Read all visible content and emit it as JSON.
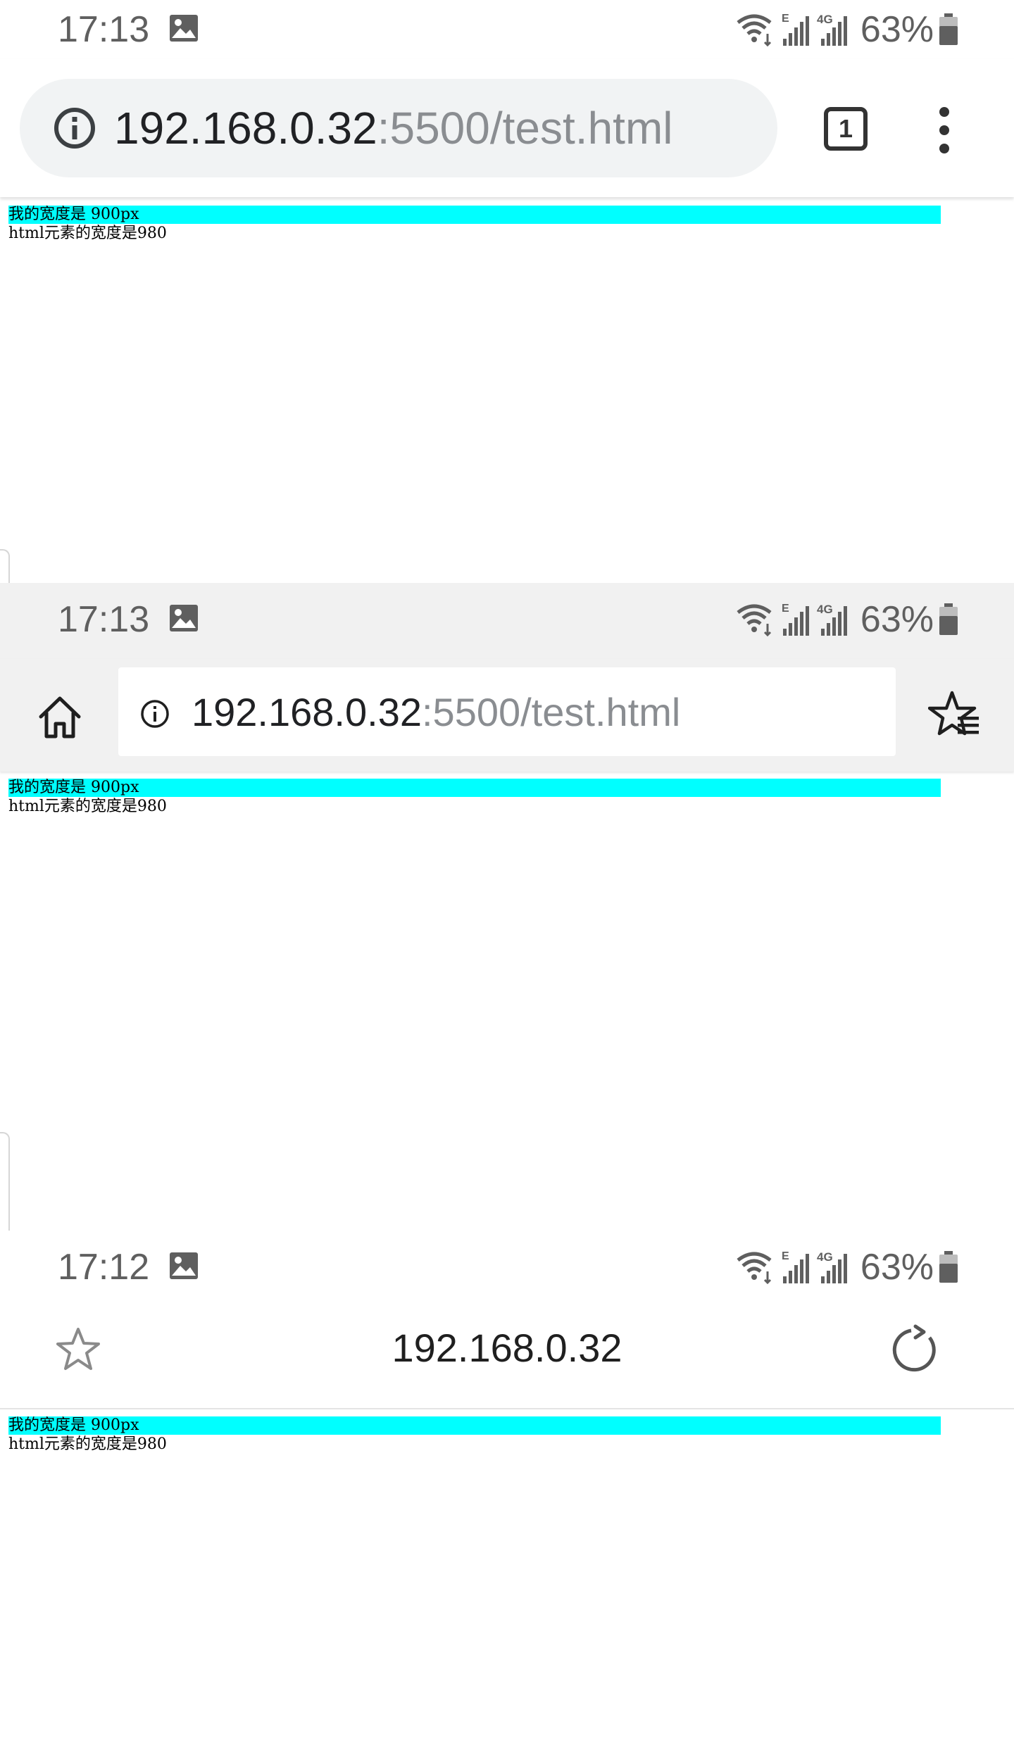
{
  "screens": [
    {
      "status": {
        "time": "17:13",
        "battery": "63%",
        "network": "4G"
      },
      "toolbar": {
        "url_host": "192.168.0.32",
        "url_path": ":5500/test.html",
        "tab_count": "1"
      },
      "page": {
        "box_text": "我的宽度是 900px",
        "note": "html元素的宽度是980"
      }
    },
    {
      "status": {
        "time": "17:13",
        "battery": "63%",
        "network": "4G"
      },
      "toolbar": {
        "url_host": "192.168.0.32",
        "url_path": ":5500/test.html"
      },
      "page": {
        "box_text": "我的宽度是 900px",
        "note": "html元素的宽度是980"
      }
    },
    {
      "status": {
        "time": "17:12",
        "battery": "63%",
        "network": "4G"
      },
      "toolbar": {
        "title": "192.168.0.32"
      },
      "page": {
        "box_text": "我的宽度是 900px",
        "note": "html元素的宽度是980"
      }
    }
  ],
  "colors": {
    "cyan_box": "#00ffff",
    "status_text": "#5f5f5f",
    "url_path": "#8a8d91"
  },
  "icons": [
    "gallery-icon",
    "wifi-icon",
    "signal-icon",
    "battery-icon",
    "info-icon",
    "tab-switcher-icon",
    "overflow-menu-icon",
    "home-icon",
    "bookmarks-icon",
    "star-icon",
    "reload-icon"
  ]
}
